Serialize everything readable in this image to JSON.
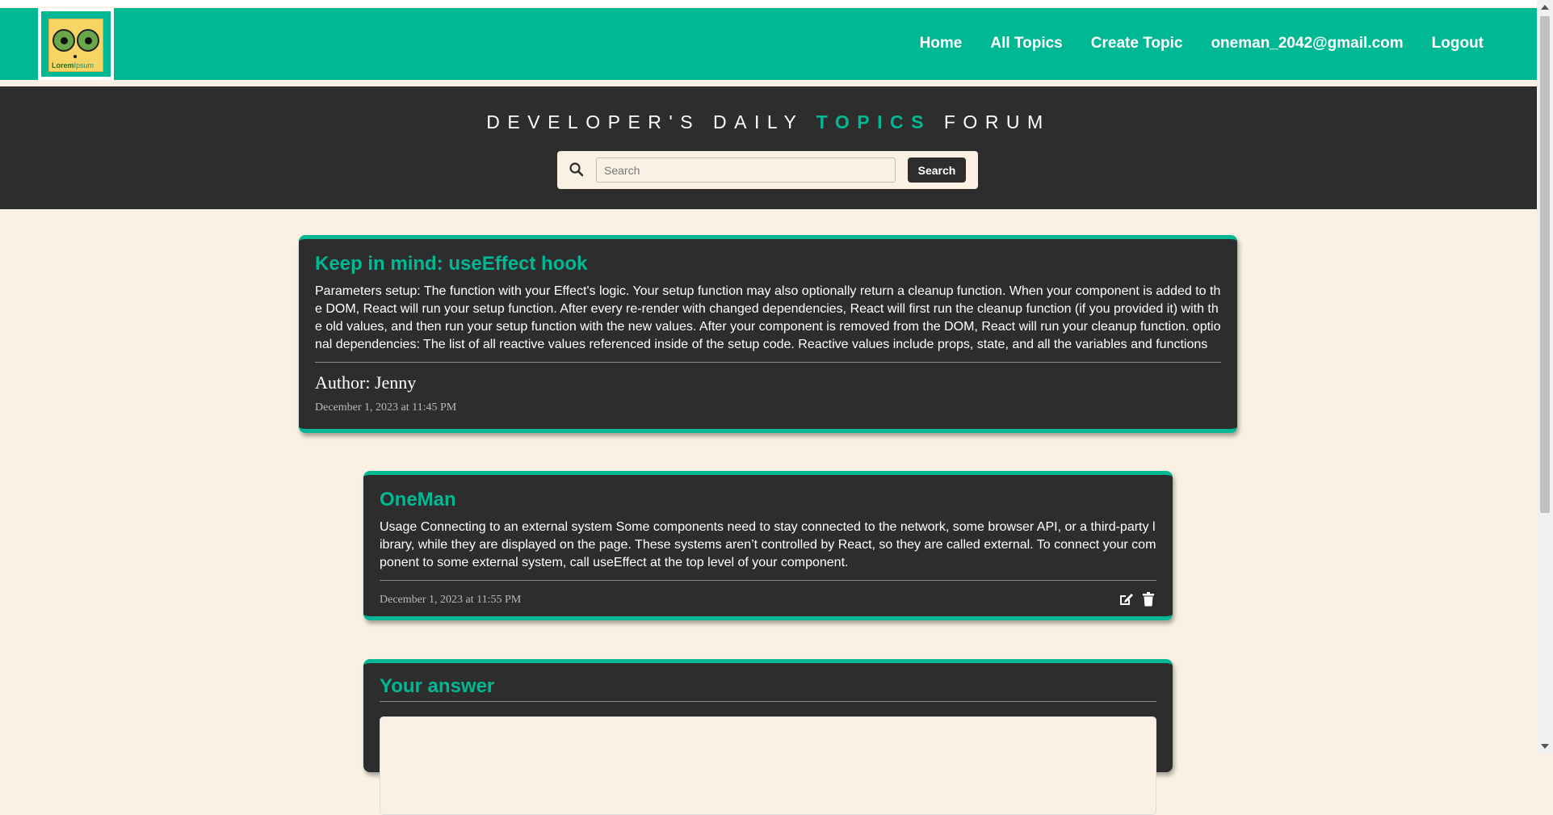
{
  "logo": {
    "text_primary": "Lorem",
    "text_secondary": "Ipsum"
  },
  "nav": {
    "items": [
      {
        "label": "Home"
      },
      {
        "label": "All Topics"
      },
      {
        "label": "Create Topic"
      },
      {
        "label": "oneman_2042@gmail.com"
      },
      {
        "label": "Logout"
      }
    ]
  },
  "hero": {
    "title_pre": "DEVELOPER'S DAILY",
    "title_accent": "TOPICS",
    "title_post": "FORUM"
  },
  "search": {
    "placeholder": "Search",
    "value": "",
    "button_label": "Search"
  },
  "topic": {
    "title": "Keep in mind: useEffect hook",
    "body": "Parameters setup: The function with your Effect's logic. Your setup function may also optionally return a cleanup function. When your component is added to the DOM, React will run your setup function. After every re-render with changed dependencies, React will first run the cleanup function (if you provided it) with the old values, and then run your setup function with the new values. After your component is removed from the DOM, React will run your cleanup function. optional dependencies: The list of all reactive values referenced inside of the setup code. Reactive values include props, state, and all the variables and functions",
    "author": "Author: Jenny",
    "date": "December 1, 2023 at 11:45 PM"
  },
  "reply": {
    "author": "OneMan",
    "body": "Usage Connecting to an external system Some components need to stay connected to the network, some browser API, or a third-party library, while they are displayed on the page. These systems aren’t controlled by React, so they are called external. To connect your component to some external system, call useEffect at the top level of your component.",
    "date": "December 1, 2023 at 11:55 PM",
    "icons": [
      "edit-icon",
      "trash-icon"
    ]
  },
  "answer": {
    "title": "Your answer"
  },
  "colors": {
    "accent": "#00b894",
    "dark": "#2d2d2d",
    "background": "#faf1e4"
  }
}
